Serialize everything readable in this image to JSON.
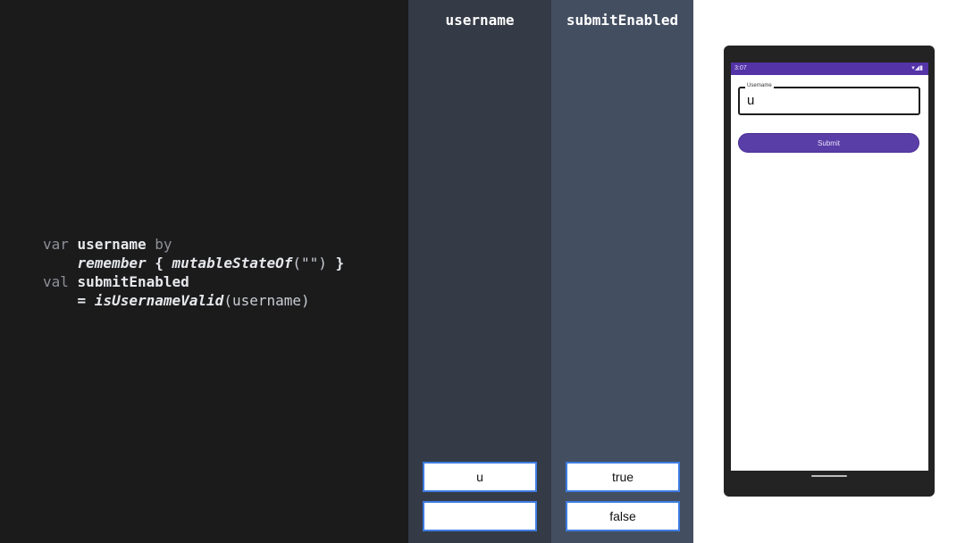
{
  "code": {
    "line1": {
      "kw": "var",
      "name": "username",
      "kw2": "by"
    },
    "line2": {
      "fn": "remember",
      "brace_open": "{",
      "fn2": "mutableStateOf",
      "args": "(\"\")",
      "brace_close": "}"
    },
    "line3": {
      "kw": "val",
      "name": "submitEnabled"
    },
    "line4": {
      "op": "=",
      "fn": "isUsernameValid",
      "args": "(username)"
    }
  },
  "columns": {
    "username": {
      "header": "username",
      "values": [
        "u",
        ""
      ]
    },
    "submitEnabled": {
      "header": "submitEnabled",
      "values": [
        "true",
        "false"
      ]
    }
  },
  "phone": {
    "status_time": "3:07",
    "status_icons": "▾◢▮",
    "text_field": {
      "label": "Username",
      "value": "u"
    },
    "submit_label": "Submit"
  },
  "colors": {
    "code_bg": "#1b1b1c",
    "username_col_bg": "#343a46",
    "submit_col_bg": "#434e61",
    "value_box_border": "#3d7be0",
    "app_primary": "#5333a6"
  }
}
